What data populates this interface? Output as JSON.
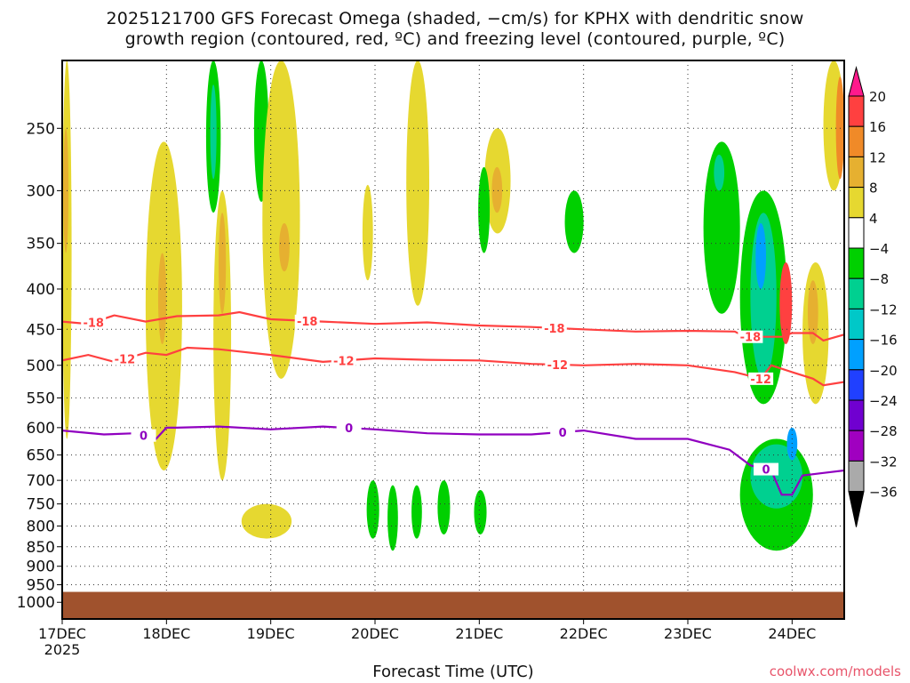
{
  "chart_data": {
    "type": "heatmap",
    "title_line1": "2025121700 GFS Forecast Omega (shaded, −cm/s) for KPHX with dendritic snow",
    "title_line2": "growth region (contoured, red, ºC) and freezing level (contoured, purple, ºC)",
    "xlabel": "Forecast Time (UTC)",
    "ylabel": "",
    "credit": "coolwx.com/models",
    "x_range_days": [
      0,
      7.5
    ],
    "y_range_hpa": [
      205,
      1050
    ],
    "y_scale": "log",
    "x_ticks": [
      {
        "day": 0,
        "label": "17DEC",
        "sub": "2025"
      },
      {
        "day": 1,
        "label": "18DEC"
      },
      {
        "day": 2,
        "label": "19DEC"
      },
      {
        "day": 3,
        "label": "20DEC"
      },
      {
        "day": 4,
        "label": "21DEC"
      },
      {
        "day": 5,
        "label": "22DEC"
      },
      {
        "day": 6,
        "label": "23DEC"
      },
      {
        "day": 7,
        "label": "24DEC"
      }
    ],
    "y_ticks": [
      "250",
      "300",
      "350",
      "400",
      "450",
      "500",
      "550",
      "600",
      "650",
      "700",
      "750",
      "800",
      "850",
      "900",
      "950",
      "1000"
    ],
    "ground_level_hpa": 970,
    "colorbar": {
      "levels": [
        "20",
        "16",
        "12",
        "8",
        "4",
        "−4",
        "−8",
        "−12",
        "−16",
        "−20",
        "−24",
        "−28",
        "−32",
        "−36"
      ],
      "colors": [
        "#ff1a8c",
        "#ff4040",
        "#f08a28",
        "#e6b030",
        "#e6d830",
        "#ffffff",
        "#00d000",
        "#00d090",
        "#00c8c8",
        "#00a0ff",
        "#2040ff",
        "#7000d0",
        "#a000c0",
        "#aaaaaa",
        "#000000"
      ]
    },
    "shaded_regions": [
      {
        "t": [
          0,
          0.09
        ],
        "p": [
          205,
          620
        ],
        "v": 4
      },
      {
        "t": [
          0.01,
          0.06
        ],
        "p": [
          250,
          360
        ],
        "v": 8
      },
      {
        "t": [
          0.8,
          1.15
        ],
        "p": [
          260,
          680
        ],
        "v": 4
      },
      {
        "t": [
          0.92,
          1.0
        ],
        "p": [
          360,
          470
        ],
        "v": 8
      },
      {
        "t": [
          1.38,
          1.52
        ],
        "p": [
          205,
          320
        ],
        "v": -4
      },
      {
        "t": [
          1.42,
          1.48
        ],
        "p": [
          220,
          290
        ],
        "v": -8
      },
      {
        "t": [
          1.45,
          1.62
        ],
        "p": [
          300,
          700
        ],
        "v": 4
      },
      {
        "t": [
          1.5,
          1.57
        ],
        "p": [
          320,
          430
        ],
        "v": 8
      },
      {
        "t": [
          1.84,
          1.98
        ],
        "p": [
          205,
          310
        ],
        "v": -4
      },
      {
        "t": [
          1.92,
          2.28
        ],
        "p": [
          205,
          520
        ],
        "v": 4
      },
      {
        "t": [
          2.08,
          2.18
        ],
        "p": [
          330,
          380
        ],
        "v": 8
      },
      {
        "t": [
          1.72,
          2.2
        ],
        "p": [
          750,
          830
        ],
        "v": 4
      },
      {
        "t": [
          2.88,
          2.98
        ],
        "p": [
          295,
          390
        ],
        "v": 4
      },
      {
        "t": [
          3.3,
          3.52
        ],
        "p": [
          205,
          420
        ],
        "v": 4
      },
      {
        "t": [
          4.05,
          4.3
        ],
        "p": [
          250,
          340
        ],
        "v": 4
      },
      {
        "t": [
          4.12,
          4.22
        ],
        "p": [
          280,
          320
        ],
        "v": 8
      },
      {
        "t": [
          3.99,
          4.1
        ],
        "p": [
          280,
          360
        ],
        "v": -4
      },
      {
        "t": [
          2.92,
          3.04
        ],
        "p": [
          700,
          830
        ],
        "v": -4
      },
      {
        "t": [
          3.12,
          3.22
        ],
        "p": [
          710,
          860
        ],
        "v": -4
      },
      {
        "t": [
          3.35,
          3.45
        ],
        "p": [
          710,
          830
        ],
        "v": -4
      },
      {
        "t": [
          3.6,
          3.72
        ],
        "p": [
          700,
          820
        ],
        "v": -4
      },
      {
        "t": [
          3.95,
          4.07
        ],
        "p": [
          720,
          820
        ],
        "v": -4
      },
      {
        "t": [
          4.82,
          5.0
        ],
        "p": [
          300,
          360
        ],
        "v": -4
      },
      {
        "t": [
          6.15,
          6.5
        ],
        "p": [
          260,
          430
        ],
        "v": -4
      },
      {
        "t": [
          6.25,
          6.35
        ],
        "p": [
          270,
          300
        ],
        "v": -8
      },
      {
        "t": [
          6.5,
          6.95
        ],
        "p": [
          300,
          560
        ],
        "v": -4
      },
      {
        "t": [
          6.6,
          6.85
        ],
        "p": [
          320,
          520
        ],
        "v": -8
      },
      {
        "t": [
          6.65,
          6.75
        ],
        "p": [
          330,
          400
        ],
        "v": -16
      },
      {
        "t": [
          6.88,
          7.0
        ],
        "p": [
          370,
          470
        ],
        "v": 16
      },
      {
        "t": [
          7.1,
          7.35
        ],
        "p": [
          370,
          560
        ],
        "v": 4
      },
      {
        "t": [
          7.15,
          7.25
        ],
        "p": [
          390,
          470
        ],
        "v": 8
      },
      {
        "t": [
          6.5,
          7.2
        ],
        "p": [
          620,
          860
        ],
        "v": -4
      },
      {
        "t": [
          6.6,
          7.1
        ],
        "p": [
          630,
          760
        ],
        "v": -8
      },
      {
        "t": [
          6.95,
          7.05
        ],
        "p": [
          600,
          660
        ],
        "v": -16
      },
      {
        "t": [
          7.3,
          7.5
        ],
        "p": [
          205,
          300
        ],
        "v": 4
      },
      {
        "t": [
          7.42,
          7.5
        ],
        "p": [
          215,
          290
        ],
        "v": 12
      }
    ],
    "contours": [
      {
        "label": "-18",
        "color": "#ff4040",
        "label_at": [
          0.3,
          2.35,
          4.72,
          6.6
        ],
        "points": [
          [
            0,
            440
          ],
          [
            0.25,
            443
          ],
          [
            0.5,
            432
          ],
          [
            0.8,
            440
          ],
          [
            1.1,
            433
          ],
          [
            1.5,
            432
          ],
          [
            1.7,
            428
          ],
          [
            2,
            437
          ],
          [
            2.5,
            440
          ],
          [
            3,
            443
          ],
          [
            3.5,
            441
          ],
          [
            4,
            445
          ],
          [
            4.5,
            447
          ],
          [
            5,
            450
          ],
          [
            5.5,
            453
          ],
          [
            6,
            452
          ],
          [
            6.45,
            453
          ],
          [
            6.55,
            460
          ],
          [
            6.9,
            460
          ],
          [
            7.0,
            455
          ],
          [
            7.2,
            455
          ],
          [
            7.3,
            465
          ],
          [
            7.5,
            457
          ]
        ]
      },
      {
        "label": "-12",
        "color": "#ff4040",
        "label_at": [
          0.6,
          2.7,
          4.75,
          6.7
        ],
        "points": [
          [
            0,
            493
          ],
          [
            0.25,
            485
          ],
          [
            0.5,
            495
          ],
          [
            0.8,
            482
          ],
          [
            1,
            485
          ],
          [
            1.2,
            475
          ],
          [
            1.5,
            477
          ],
          [
            2,
            485
          ],
          [
            2.5,
            495
          ],
          [
            3,
            490
          ],
          [
            3.5,
            492
          ],
          [
            4,
            493
          ],
          [
            4.5,
            498
          ],
          [
            5,
            500
          ],
          [
            5.5,
            498
          ],
          [
            6,
            500
          ],
          [
            6.45,
            510
          ],
          [
            6.7,
            520
          ],
          [
            6.8,
            500
          ],
          [
            7,
            510
          ],
          [
            7.2,
            520
          ],
          [
            7.3,
            530
          ],
          [
            7.5,
            525
          ]
        ]
      },
      {
        "label": "0",
        "color": "#9000c0",
        "label_at": [
          0.78,
          2.75,
          4.8,
          6.75
        ],
        "points": [
          [
            0,
            605
          ],
          [
            0.4,
            612
          ],
          [
            0.7,
            610
          ],
          [
            0.9,
            620
          ],
          [
            1.0,
            600
          ],
          [
            1.1,
            600
          ],
          [
            1.5,
            598
          ],
          [
            2,
            603
          ],
          [
            2.5,
            598
          ],
          [
            3,
            603
          ],
          [
            3.5,
            610
          ],
          [
            4,
            612
          ],
          [
            4.5,
            612
          ],
          [
            5,
            605
          ],
          [
            5.5,
            620
          ],
          [
            6,
            620
          ],
          [
            6.4,
            640
          ],
          [
            6.6,
            670
          ],
          [
            6.8,
            680
          ],
          [
            6.9,
            730
          ],
          [
            7.0,
            730
          ],
          [
            7.1,
            690
          ],
          [
            7.3,
            685
          ],
          [
            7.5,
            680
          ]
        ]
      }
    ]
  }
}
